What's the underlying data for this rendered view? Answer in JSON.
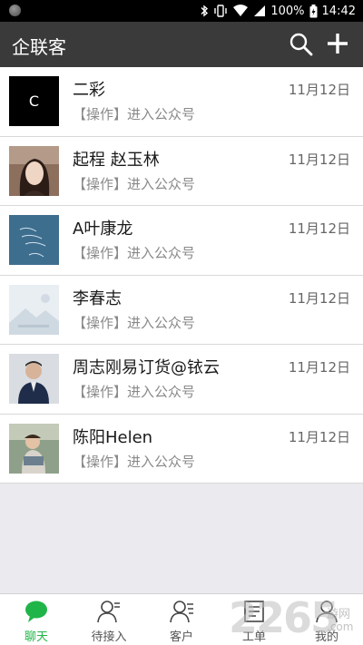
{
  "status_bar": {
    "battery": "100%",
    "time": "14:42"
  },
  "app_bar": {
    "title": "企联客"
  },
  "chats": [
    {
      "name": "二彩",
      "time": "11月12日",
      "preview": "【操作】进入公众号",
      "avatar_text": "C"
    },
    {
      "name": "起程 赵玉林",
      "time": "11月12日",
      "preview": "【操作】进入公众号"
    },
    {
      "name": "A叶康龙",
      "time": "11月12日",
      "preview": "【操作】进入公众号"
    },
    {
      "name": "李春志",
      "time": "11月12日",
      "preview": "【操作】进入公众号"
    },
    {
      "name": "周志刚易订货@铱云",
      "time": "11月12日",
      "preview": "【操作】进入公众号"
    },
    {
      "name": "陈阳Helen",
      "time": "11月12日",
      "preview": "【操作】进入公众号"
    }
  ],
  "bottom_nav": [
    {
      "label": "聊天",
      "icon": "chat-bubble-icon",
      "active": true
    },
    {
      "label": "待接入",
      "icon": "person-waiting-icon",
      "active": false
    },
    {
      "label": "客户",
      "icon": "contacts-icon",
      "active": false
    },
    {
      "label": "工单",
      "icon": "ticket-icon",
      "active": false
    },
    {
      "label": "我的",
      "icon": "profile-icon",
      "active": false
    }
  ],
  "watermark": {
    "text": "2265",
    "site": "游网",
    "domain": ".com"
  },
  "colors": {
    "app_bar": "#3a3a3a",
    "accent": "#20b548",
    "background": "#ebebef"
  }
}
